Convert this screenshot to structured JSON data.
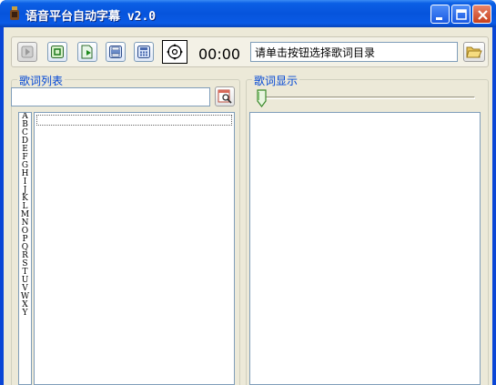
{
  "window": {
    "title": "语音平台自动字幕 v2.0"
  },
  "toolbar": {
    "time": "00:00",
    "directory_text": "请单击按钮选择歌词目录"
  },
  "lyric_list": {
    "label": "歌词列表",
    "search_value": "",
    "letters": [
      "A",
      "B",
      "C",
      "D",
      "E",
      "F",
      "G",
      "H",
      "I",
      "J",
      "K",
      "L",
      "M",
      "N",
      "O",
      "P",
      "Q",
      "R",
      "S",
      "T",
      "U",
      "V",
      "W",
      "X",
      "Y"
    ]
  },
  "lyric_display": {
    "label": "歌词显示",
    "progress": 0
  }
}
